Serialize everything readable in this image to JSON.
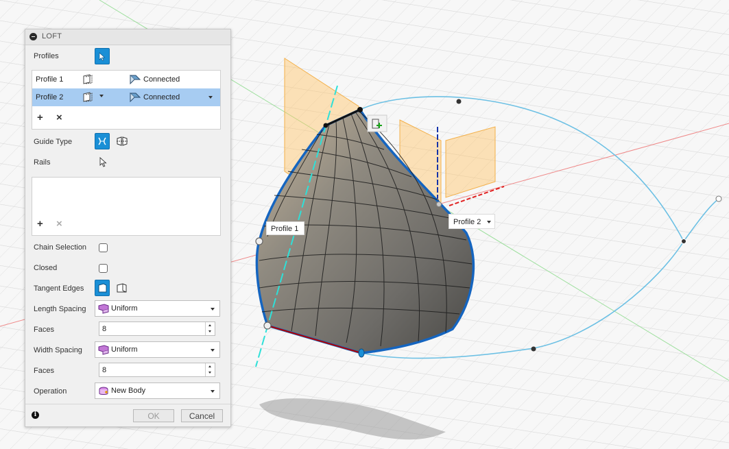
{
  "dialog": {
    "title": "LOFT",
    "profiles_label": "Profiles",
    "profiles": [
      {
        "name": "Profile 1",
        "continuity": "Connected",
        "selected": false
      },
      {
        "name": "Profile 2",
        "continuity": "Connected",
        "selected": true
      }
    ],
    "guide_type_label": "Guide Type",
    "rails_label": "Rails",
    "chain_selection_label": "Chain Selection",
    "chain_selection_checked": false,
    "closed_label": "Closed",
    "closed_checked": false,
    "tangent_edges_label": "Tangent Edges",
    "length_spacing_label": "Length Spacing",
    "length_spacing_value": "Uniform",
    "faces_label_1": "Faces",
    "faces_value_1": "8",
    "width_spacing_label": "Width Spacing",
    "width_spacing_value": "Uniform",
    "faces_label_2": "Faces",
    "faces_value_2": "8",
    "operation_label": "Operation",
    "operation_value": "New Body",
    "ok_label": "OK",
    "cancel_label": "Cancel"
  },
  "viewport": {
    "profile1_label": "Profile 1",
    "profile2_label": "Profile 2"
  },
  "colors": {
    "accent_blue": "#1a8fd6",
    "selection_row": "#a7ccf2",
    "curve": "#6cc0e4",
    "profile_plane": "#ffc466",
    "grid": "#dddddd"
  },
  "icons": [
    "collapse-icon",
    "select-arrow-icon",
    "profile-icon",
    "connected-icon",
    "guide-rails-icon",
    "guide-centerline-icon",
    "tangent-edges-icon",
    "spacing-icon",
    "new-body-icon",
    "info-icon",
    "add-icon",
    "remove-icon"
  ]
}
